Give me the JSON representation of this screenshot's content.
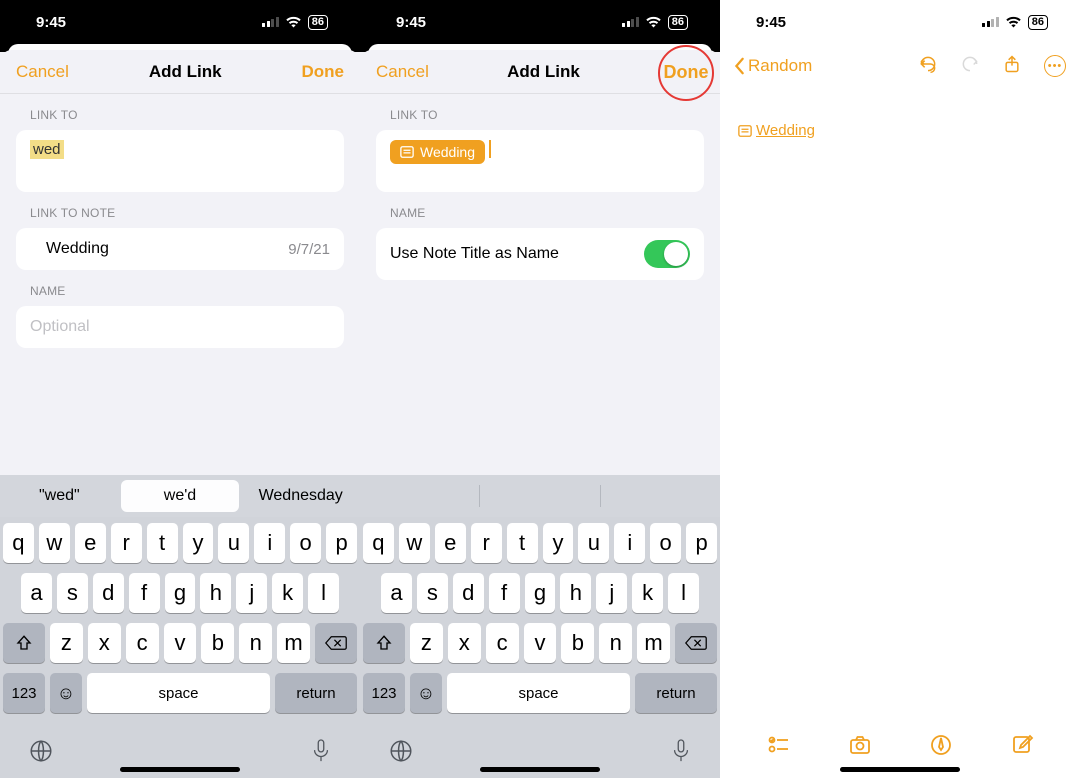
{
  "status": {
    "time": "9:45",
    "battery": "86"
  },
  "screen1": {
    "cancel": "Cancel",
    "title": "Add Link",
    "done": "Done",
    "linkto_label": "LINK TO",
    "typed": "wed",
    "linktonote_label": "LINK TO NOTE",
    "note_suggestion": {
      "title": "Wedding",
      "date": "9/7/21"
    },
    "name_label": "NAME",
    "name_placeholder": "Optional",
    "suggestions": [
      "\"wed\"",
      "we'd",
      "Wednesday"
    ]
  },
  "screen2": {
    "cancel": "Cancel",
    "title": "Add Link",
    "done": "Done",
    "linkto_label": "LINK TO",
    "chip": "Wedding",
    "name_label": "NAME",
    "use_title_label": "Use Note Title as Name"
  },
  "screen3": {
    "back": "Random",
    "link_text": "Wedding"
  },
  "keyboard": {
    "row1": [
      "q",
      "w",
      "e",
      "r",
      "t",
      "y",
      "u",
      "i",
      "o",
      "p"
    ],
    "row2": [
      "a",
      "s",
      "d",
      "f",
      "g",
      "h",
      "j",
      "k",
      "l"
    ],
    "row3": [
      "z",
      "x",
      "c",
      "v",
      "b",
      "n",
      "m"
    ],
    "k123": "123",
    "space": "space",
    "return": "return"
  }
}
